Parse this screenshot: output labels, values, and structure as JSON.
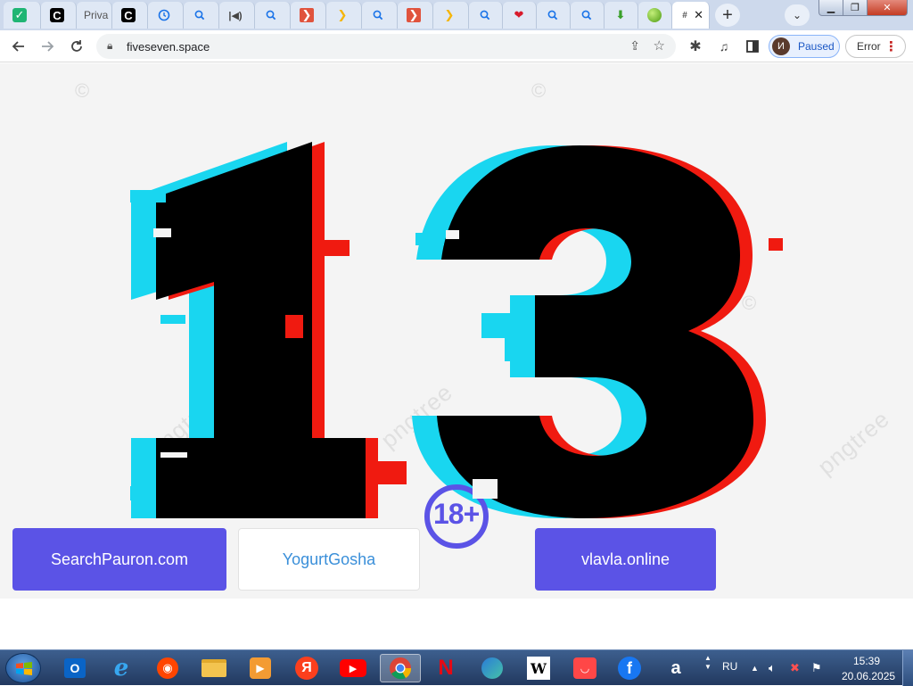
{
  "browser": {
    "tabs": [
      {
        "favicon": "check-icon",
        "title": ""
      },
      {
        "favicon": "c-icon",
        "title": ""
      },
      {
        "favicon": "generic-icon",
        "title": "Priva"
      },
      {
        "favicon": "c-icon",
        "title": ""
      },
      {
        "favicon": "history-icon",
        "title": ""
      },
      {
        "favicon": "search-icon",
        "title": ""
      },
      {
        "favicon": "audio-icon",
        "title": ""
      },
      {
        "favicon": "search-icon",
        "title": ""
      },
      {
        "favicon": "red-play-icon",
        "title": ""
      },
      {
        "favicon": "yellow-arrow-icon",
        "title": ""
      },
      {
        "favicon": "search-icon",
        "title": ""
      },
      {
        "favicon": "red-play-icon",
        "title": ""
      },
      {
        "favicon": "yellow-arrow-icon",
        "title": ""
      },
      {
        "favicon": "search-icon",
        "title": ""
      },
      {
        "favicon": "heart-icon",
        "title": ""
      },
      {
        "favicon": "search-icon",
        "title": ""
      },
      {
        "favicon": "search-icon",
        "title": ""
      },
      {
        "favicon": "download-arrow-icon",
        "title": ""
      },
      {
        "favicon": "green-ball-icon",
        "title": ""
      },
      {
        "favicon": "hash-icon",
        "title": ""
      }
    ],
    "address_bar": {
      "url": "fiveseven.space"
    },
    "profile": {
      "initial": "И",
      "status": "Paused"
    },
    "error_label": "Error"
  },
  "page": {
    "badge": "18+",
    "watermark": "pngtree",
    "buttons": [
      {
        "label": "SearchPauron.com"
      },
      {
        "label": "YogurtGosha"
      },
      {
        "label": "vlavla.online"
      }
    ],
    "colors": {
      "primary": "#5b53e6",
      "link": "#3a8fd9",
      "badge": "#5b53e6"
    }
  },
  "taskbar": {
    "apps": [
      "outlook-icon",
      "ie-icon",
      "reddit-icon",
      "file-explorer-icon",
      "media-player-icon",
      "yandex-icon",
      "youtube-icon",
      "chrome-icon",
      "netflix-icon",
      "edge-icon",
      "wikipedia-icon",
      "aliexpress-icon",
      "facebook-icon",
      "amazon-icon"
    ],
    "language": "RU",
    "time": "15:39",
    "date": "20.06.2025"
  }
}
